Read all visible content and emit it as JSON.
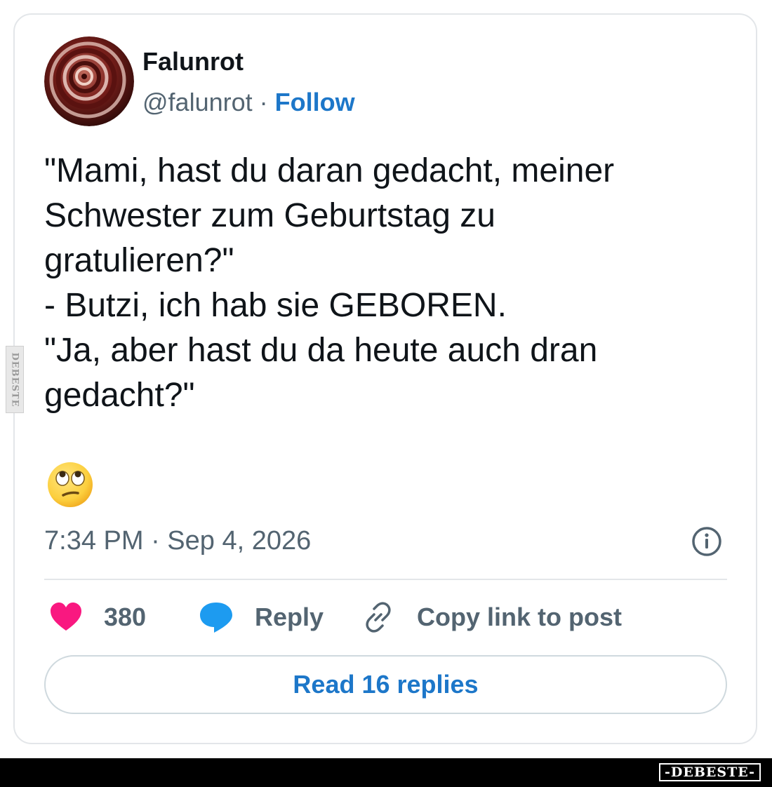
{
  "post": {
    "author": {
      "display_name": "Falunrot",
      "handle": "@falunrot",
      "separator": " · ",
      "follow_label": "Follow",
      "avatar": "swirl-avatar"
    },
    "text": "\"Mami, hast du daran gedacht, meiner\nSchwester zum Geburtstag zu\ngratulieren?\"\n- Butzi, ich hab sie GEBOREN.\n\"Ja, aber hast du da heute auch dran\ngedacht?\"",
    "emoji": "face-with-rolling-eyes",
    "timestamp": "7:34 PM · Sep 4, 2026",
    "info_icon": "info-icon",
    "actions": {
      "likes": {
        "icon": "heart-icon",
        "count": "380",
        "color": "#f91880"
      },
      "reply": {
        "icon": "speech-bubble-icon",
        "label": "Reply",
        "color": "#1d9bf0"
      },
      "copy_link": {
        "icon": "link-icon",
        "label": "Copy link to post"
      }
    },
    "read_replies_label": "Read 16 replies"
  },
  "watermark": {
    "side": "DEBESTE",
    "footer": "-DEBESTE-"
  },
  "colors": {
    "text": "#0f1419",
    "secondary": "#536471",
    "link": "#1d77c9",
    "border": "#e3e6e9"
  }
}
